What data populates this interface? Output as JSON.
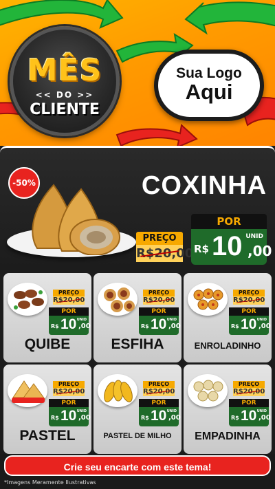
{
  "header": {
    "badge": {
      "line1": "MÊS",
      "line2": "<< DO >>",
      "line3": "CLIENTE"
    },
    "logo": {
      "line1": "Sua Logo",
      "line2": "Aqui"
    }
  },
  "hero": {
    "discount": "-50%",
    "title": "COXINHA",
    "preco_label": "PREÇO",
    "old_price": "R$20,00",
    "por_label": "POR",
    "currency": "R$",
    "price_int": "10",
    "price_dec": ",00",
    "unit": "UNID"
  },
  "products": [
    {
      "name": "QUIBE",
      "preco_label": "PREÇO",
      "old_price": "R$20,00",
      "por_label": "POR",
      "currency": "R$",
      "price_int": "10",
      "price_dec": ",00",
      "unit": "UNID",
      "icon": "quibe-icon"
    },
    {
      "name": "ESFIHA",
      "preco_label": "PREÇO",
      "old_price": "R$20,00",
      "por_label": "POR",
      "currency": "R$",
      "price_int": "10",
      "price_dec": ",00",
      "unit": "UNID",
      "icon": "esfiha-icon"
    },
    {
      "name": "ENROLADINHO",
      "preco_label": "PREÇO",
      "old_price": "R$20,00",
      "por_label": "POR",
      "currency": "R$",
      "price_int": "10",
      "price_dec": ",00",
      "unit": "UNID",
      "icon": "enroladinho-icon"
    },
    {
      "name": "PASTEL",
      "preco_label": "PREÇO",
      "old_price": "R$20,00",
      "por_label": "POR",
      "currency": "R$",
      "price_int": "10",
      "price_dec": ",00",
      "unit": "UNID",
      "icon": "pastel-icon"
    },
    {
      "name": "PASTEL DE MILHO",
      "preco_label": "PREÇO",
      "old_price": "R$20,00",
      "por_label": "POR",
      "currency": "R$",
      "price_int": "10",
      "price_dec": ",00",
      "unit": "UNID",
      "icon": "pastel-de-milho-icon"
    },
    {
      "name": "EMPADINHA",
      "preco_label": "PREÇO",
      "old_price": "R$20,00",
      "por_label": "POR",
      "currency": "R$",
      "price_int": "10",
      "price_dec": ",00",
      "unit": "UNID",
      "icon": "empadinha-icon"
    }
  ],
  "footer": {
    "cta": "Crie seu encarte com este tema!",
    "disclaimer": "*Imagens Meramente Ilustrativas"
  },
  "colors": {
    "brand_orange": "#ff9a00",
    "price_green": "#1f6b2a",
    "label_yellow": "#f7a900",
    "accent_red": "#e8231f"
  }
}
